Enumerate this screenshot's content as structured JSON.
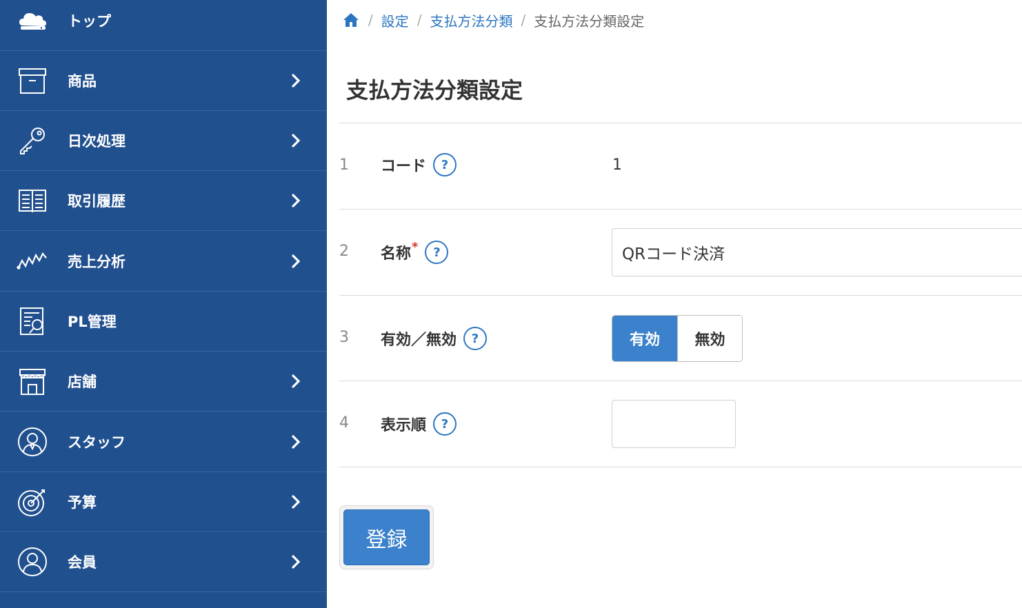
{
  "sidebar": {
    "items": [
      {
        "label": "トップ",
        "icon": "cloud-icon",
        "has_chevron": false
      },
      {
        "label": "商品",
        "icon": "box-icon",
        "has_chevron": true
      },
      {
        "label": "日次処理",
        "icon": "key-icon",
        "has_chevron": true
      },
      {
        "label": "取引履歴",
        "icon": "book-icon",
        "has_chevron": true
      },
      {
        "label": "売上分析",
        "icon": "chart-line-icon",
        "has_chevron": true
      },
      {
        "label": "PL管理",
        "icon": "report-search-icon",
        "has_chevron": false
      },
      {
        "label": "店舗",
        "icon": "store-icon",
        "has_chevron": true
      },
      {
        "label": "スタッフ",
        "icon": "staff-icon",
        "has_chevron": true
      },
      {
        "label": "予算",
        "icon": "target-icon",
        "has_chevron": true
      },
      {
        "label": "会員",
        "icon": "member-icon",
        "has_chevron": true
      }
    ],
    "bg_color": "#21508f"
  },
  "breadcrumb": {
    "separator": "/",
    "items": [
      "設定",
      "支払方法分類"
    ],
    "current": "支払方法分類設定"
  },
  "page_title": "支払方法分類設定",
  "form": {
    "help_mark": "?",
    "required_mark": "*",
    "rows": [
      {
        "num": "1",
        "label": "コード",
        "value": "1"
      },
      {
        "num": "2",
        "label": "名称",
        "value": "QRコード決済"
      },
      {
        "num": "3",
        "label": "有効／無効",
        "options": [
          "有効",
          "無効"
        ],
        "selected": "有効"
      },
      {
        "num": "4",
        "label": "表示順",
        "value": ""
      }
    ]
  },
  "submit_label": "登録",
  "colors": {
    "accent": "#3b81cb",
    "link": "#2c76c1",
    "required": "#d9342b"
  }
}
